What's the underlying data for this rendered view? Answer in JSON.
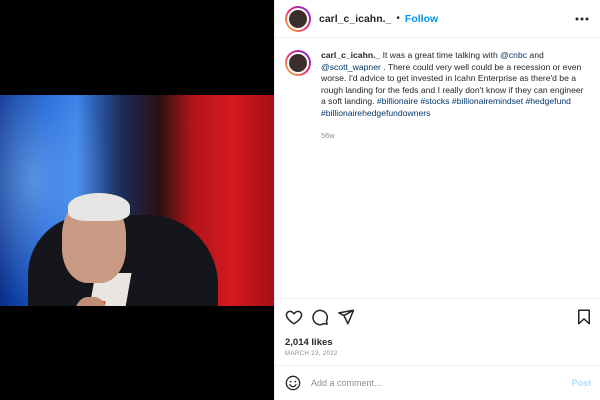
{
  "header": {
    "username": "carl_c_icahn._",
    "separator": "•",
    "follow_label": "Follow",
    "more_icon": "more-horizontal-icon"
  },
  "caption": {
    "username": "carl_c_icahn._",
    "text_1": " It was a great time talking with ",
    "mention_1": "@cnbc",
    "text_2": " and ",
    "mention_2": "@scott_wapner",
    "text_3": " . There could very well could be a recession or even worse. I'd advice to get invested in Icahn Enterprise as there'd be a rough landing for the feds and I really don't know if they can engineer a soft landing. ",
    "hashtags": [
      "#billionaire",
      "#stocks",
      "#billionairemindset",
      "#hedgefund",
      "#billionairehedgefundowners"
    ],
    "time_ago": "56w"
  },
  "actions": {
    "like_icon": "heart-icon",
    "comment_icon": "comment-icon",
    "share_icon": "send-icon",
    "save_icon": "bookmark-icon"
  },
  "stats": {
    "likes": "2,014 likes",
    "date": "MARCH 23, 2022"
  },
  "comment_box": {
    "emoji_icon": "smiley-icon",
    "placeholder": "Add a comment...",
    "post_label": "Post"
  },
  "colors": {
    "accent": "#0095f6",
    "link": "#00376b",
    "muted": "#8e8e8e",
    "post_disabled": "#b2dffc"
  }
}
